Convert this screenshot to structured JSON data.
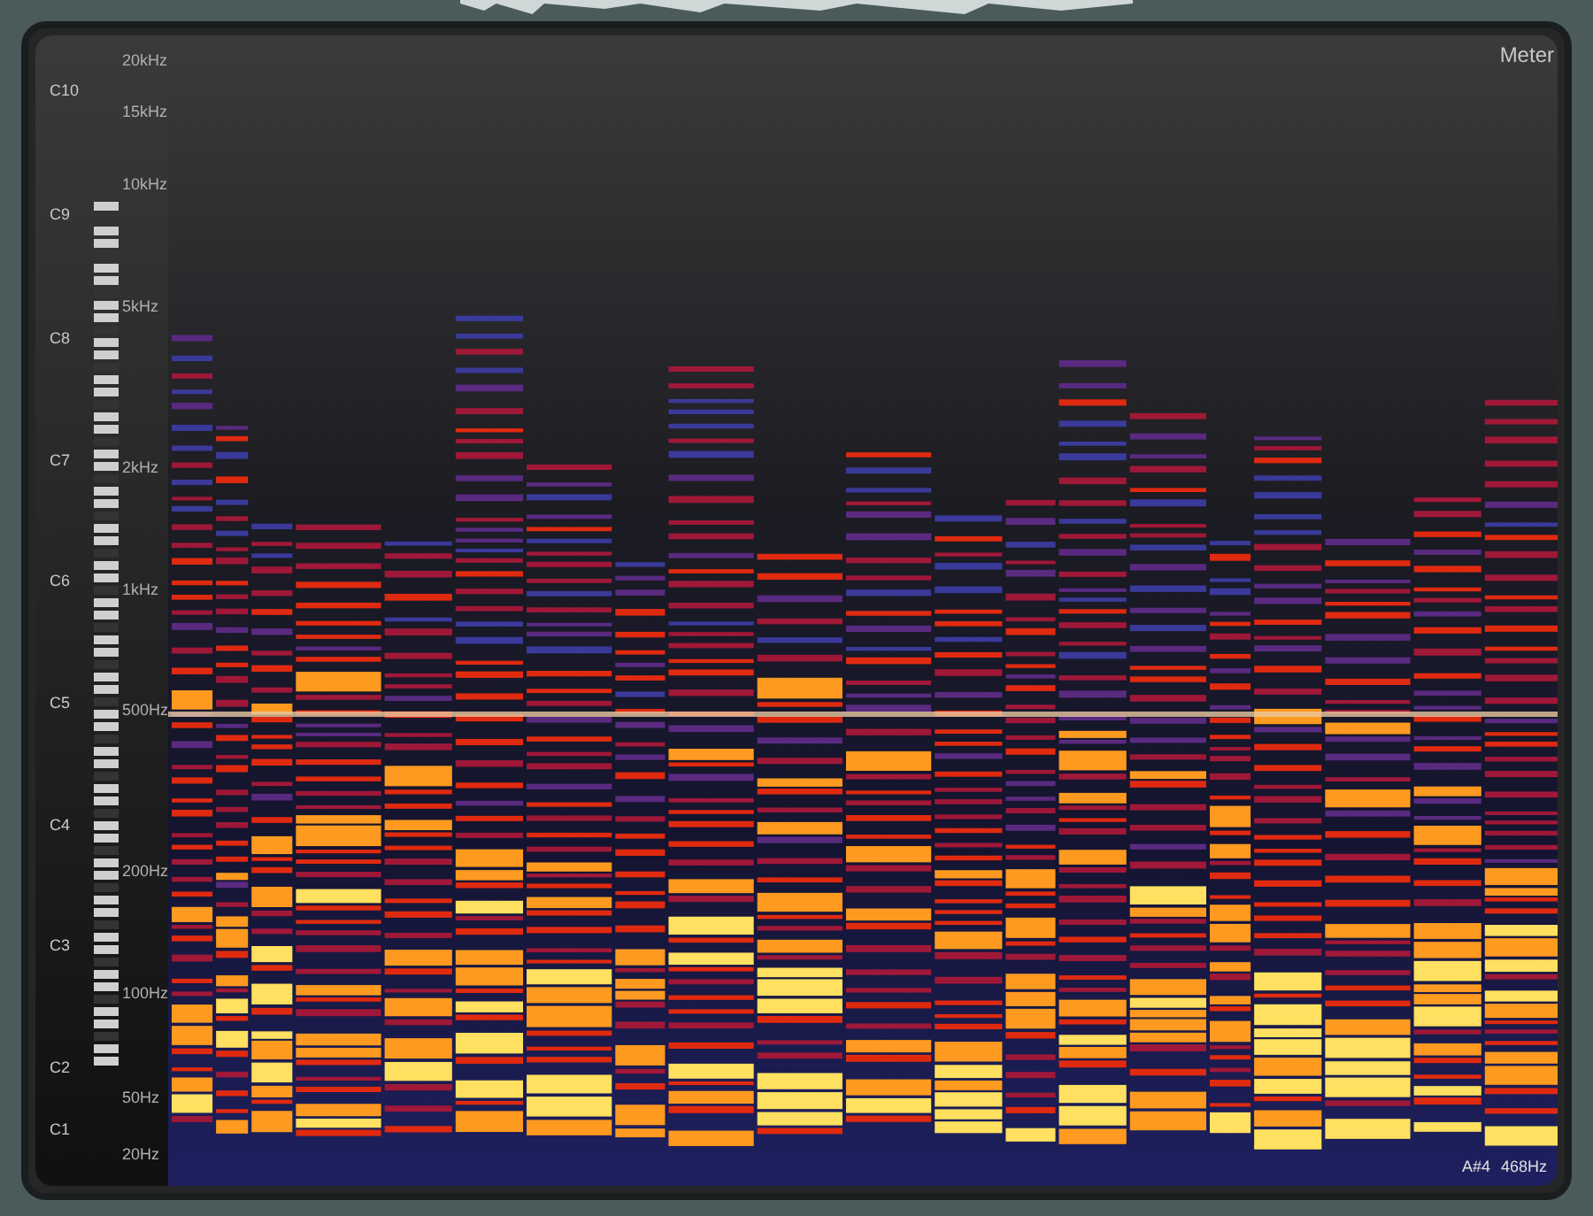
{
  "panel": {
    "title": "Meter"
  },
  "note_labels": [
    "C10",
    "C9",
    "C8",
    "C7",
    "C6",
    "C5",
    "C4",
    "C3",
    "C2",
    "C1"
  ],
  "frequency_labels": [
    "20kHz",
    "15kHz",
    "10kHz",
    "5kHz",
    "2kHz",
    "1kHz",
    "500Hz",
    "200Hz",
    "100Hz",
    "50Hz",
    "20Hz"
  ],
  "readout": {
    "note": "A#4",
    "frequency": "468Hz"
  }
}
